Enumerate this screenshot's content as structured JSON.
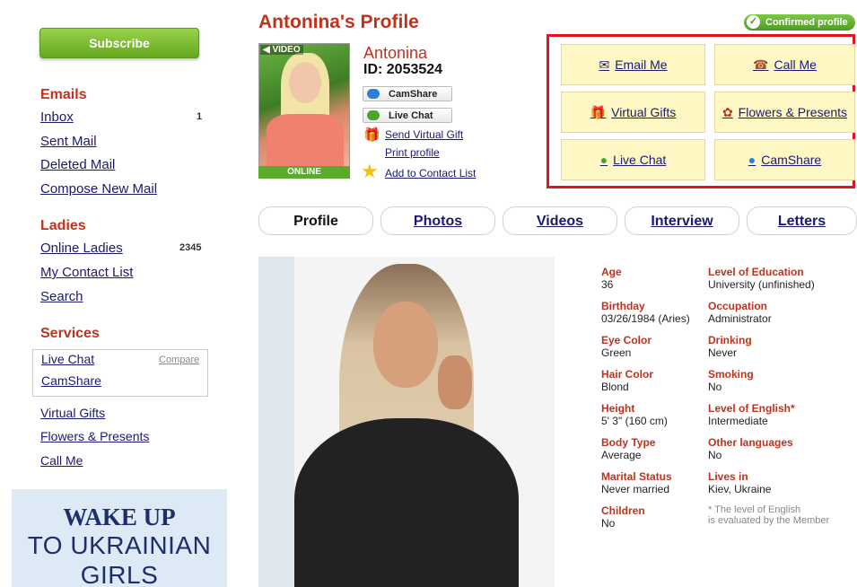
{
  "sidebar": {
    "subscribe_label": "Subscribe",
    "emails": {
      "title": "Emails",
      "inbox": "Inbox",
      "inbox_count": "1",
      "sent": "Sent Mail",
      "deleted": "Deleted Mail",
      "compose": "Compose New Mail"
    },
    "ladies": {
      "title": "Ladies",
      "online": "Online Ladies",
      "online_count": "2345",
      "contacts": "My Contact List",
      "search": "Search"
    },
    "services": {
      "title": "Services",
      "live_chat": "Live Chat",
      "compare": "Compare",
      "camshare": "CamShare",
      "virtual_gifts": "Virtual Gifts",
      "flowers": "Flowers & Presents",
      "call_me": "Call Me"
    },
    "banner": {
      "line1": "WAKE UP",
      "line2": "TO UKRAINIAN",
      "line3": "GIRLS"
    }
  },
  "header": {
    "title": "Antonina's Profile",
    "confirmed": "Confirmed profile"
  },
  "profile": {
    "video_tag": "VIDEO",
    "online_tag": "ONLINE",
    "name": "Antonina",
    "id_label": "ID: 2053524",
    "camshare_btn": "CamShare",
    "livechat_btn": "Live Chat",
    "send_gift": "Send Virtual Gift",
    "print": "Print profile",
    "add_contact": "Add to Contact List"
  },
  "actions": {
    "email": "Email Me",
    "call": "Call Me",
    "gifts": "Virtual Gifts",
    "flowers": "Flowers & Presents",
    "live_chat": "Live Chat",
    "camshare": "CamShare"
  },
  "tabs": [
    "Profile",
    "Photos",
    "Videos",
    "Interview",
    "Letters"
  ],
  "details": {
    "age": {
      "label": "Age",
      "value": "36"
    },
    "education": {
      "label": "Level of Education",
      "value": "University (unfinished)"
    },
    "birthday": {
      "label": "Birthday",
      "value": "03/26/1984 (Aries)"
    },
    "occupation": {
      "label": "Occupation",
      "value": "Administrator"
    },
    "eye": {
      "label": "Eye Color",
      "value": "Green"
    },
    "drinking": {
      "label": "Drinking",
      "value": "Never"
    },
    "hair": {
      "label": "Hair Color",
      "value": "Blond"
    },
    "smoking": {
      "label": "Smoking",
      "value": "No"
    },
    "height": {
      "label": "Height",
      "value": "5' 3\" (160 cm)"
    },
    "english": {
      "label": "Level of English*",
      "value": "Intermediate"
    },
    "body": {
      "label": "Body Type",
      "value": "Average"
    },
    "languages": {
      "label": "Other languages",
      "value": "No"
    },
    "marital": {
      "label": "Marital Status",
      "value": "Never married"
    },
    "lives": {
      "label": "Lives in",
      "city": "Kiev",
      "country": ", Ukraine"
    },
    "children": {
      "label": "Children",
      "value": "No"
    },
    "note1": "* The level of English",
    "note2": "is evaluated by the Member"
  }
}
